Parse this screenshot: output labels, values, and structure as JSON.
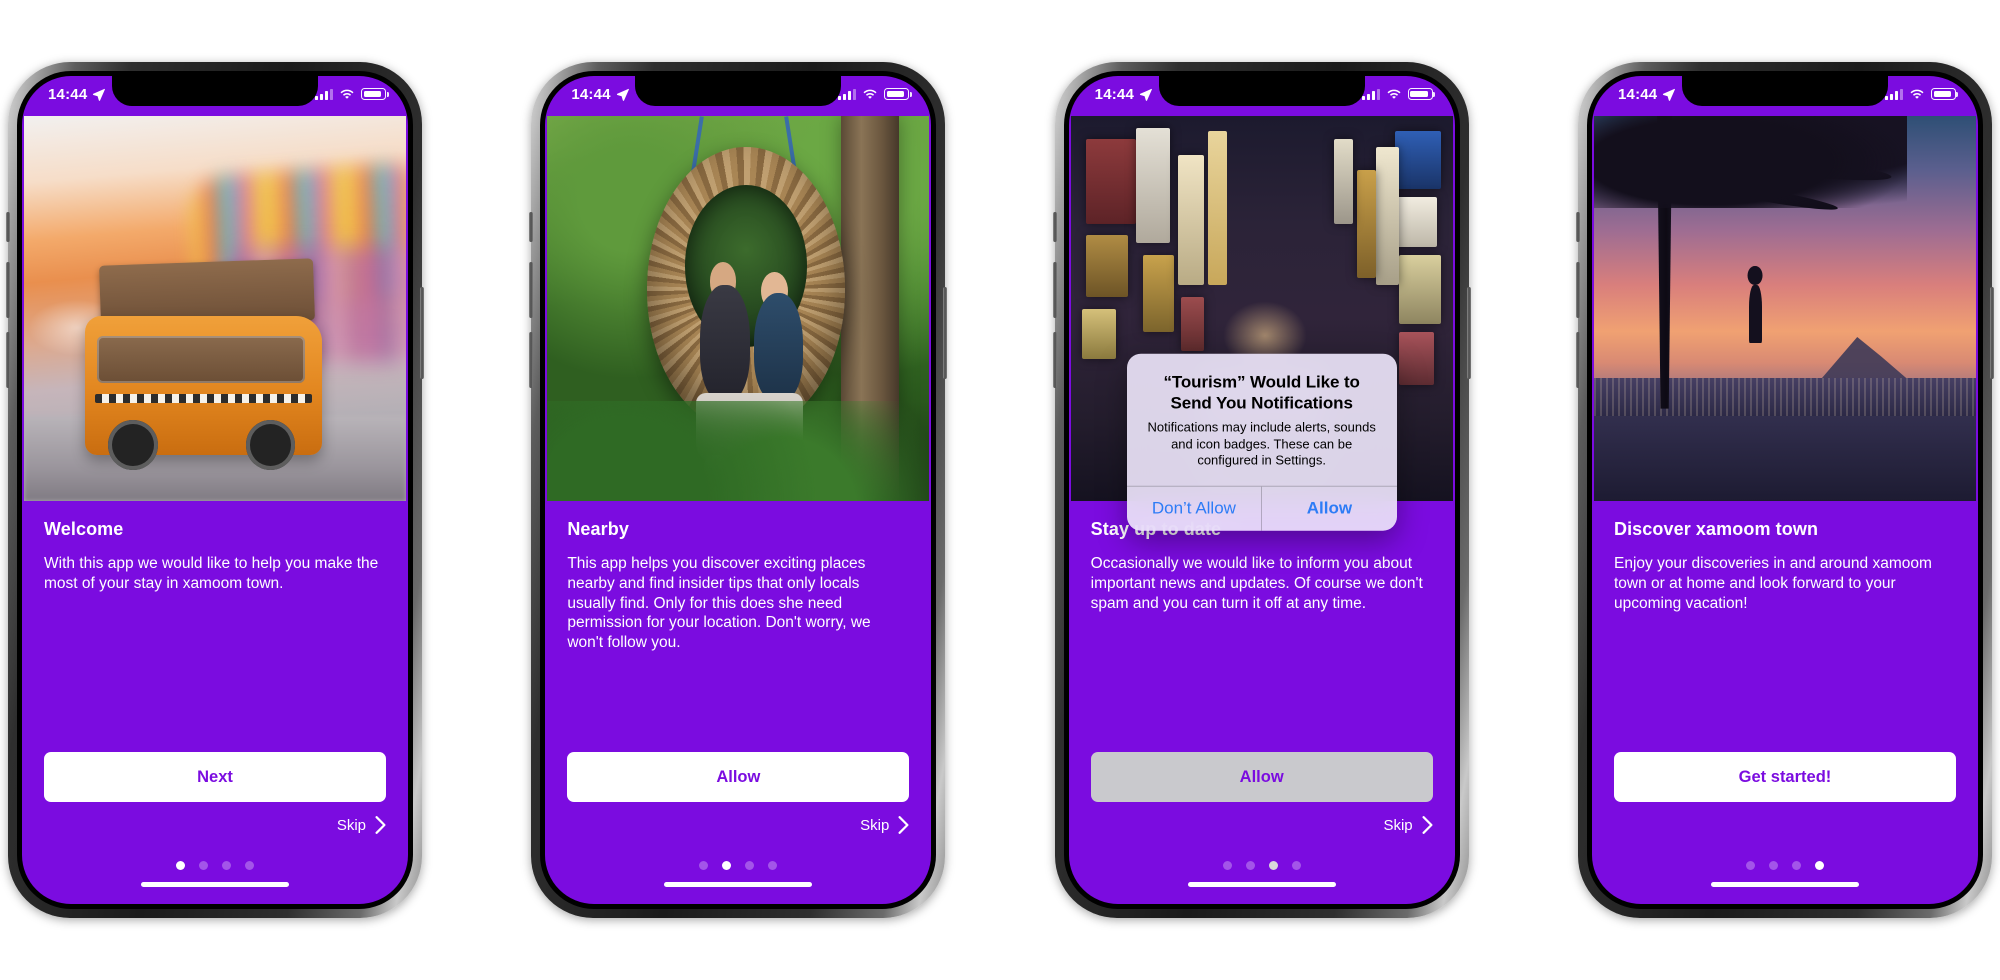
{
  "theme": {
    "brand_purple": "#7B0CE0",
    "cta_text_color": "#7B0CE0",
    "alert_blue": "#2d7cf6",
    "dimmed_button": "#c9c9cd"
  },
  "status_bar": {
    "time": "14:44",
    "location_icon": "location-arrow-icon",
    "signal_icon": "cellular-signal-icon",
    "wifi_icon": "wifi-icon",
    "battery_icon": "battery-icon"
  },
  "common": {
    "skip_label": "Skip",
    "skip_chevron_icon": "chevron-right-icon"
  },
  "alert": {
    "title": "“Tourism” Would Like to Send You Notifications",
    "message": "Notifications may include alerts, sounds and icon badges. These can be configured in Settings.",
    "deny_label": "Don’t Allow",
    "allow_label": "Allow"
  },
  "screens": [
    {
      "index": 1,
      "image_name": "toy-campervan-with-luggage-photo",
      "title": "Welcome",
      "body": "With this app we would like to help you make the most of your stay in xamoom town.",
      "cta_label": "Next",
      "cta_state": "normal",
      "show_skip": true,
      "active_dot": 0,
      "dot_count": 4,
      "has_alert": false
    },
    {
      "index": 2,
      "image_name": "couple-in-jungle-nest-swing-photo",
      "title": "Nearby",
      "body": "This app helps you discover exciting places nearby and find insider tips that only locals usually find. Only for this does she need permission for your location. Don't worry, we won't follow you.",
      "cta_label": "Allow",
      "cta_state": "normal",
      "show_skip": true,
      "active_dot": 1,
      "dot_count": 4,
      "has_alert": false
    },
    {
      "index": 3,
      "image_name": "tokyo-neon-alley-at-night-photo",
      "title": "Stay up to date",
      "body": "Occasionally we would like to inform you about important news and updates. Of course we don't spam and you can turn it off at any time.",
      "cta_label": "Allow",
      "cta_state": "dimmed",
      "show_skip": true,
      "active_dot": 2,
      "dot_count": 4,
      "has_alert": true
    },
    {
      "index": 4,
      "image_name": "sunset-overlook-with-tree-photo",
      "title": "Discover xamoom town",
      "body": "Enjoy your discoveries in and around xamoom town or at home and look forward to your upcoming vacation!",
      "cta_label": "Get started!",
      "cta_state": "normal",
      "show_skip": false,
      "active_dot": 3,
      "dot_count": 4,
      "has_alert": false
    }
  ]
}
